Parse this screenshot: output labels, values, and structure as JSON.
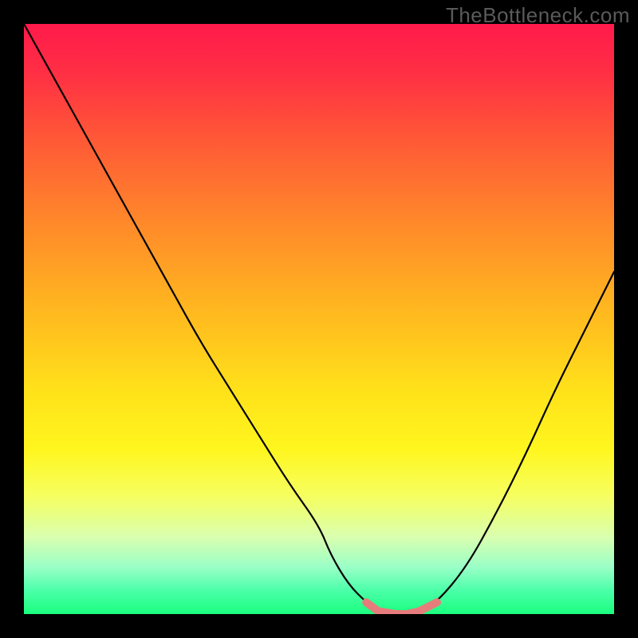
{
  "watermark": "TheBottleneck.com",
  "chart_data": {
    "type": "line",
    "title": "",
    "xlabel": "",
    "ylabel": "",
    "xlim": [
      0,
      100
    ],
    "ylim": [
      0,
      100
    ],
    "x": [
      0,
      5,
      10,
      15,
      20,
      25,
      30,
      35,
      40,
      45,
      50,
      52,
      55,
      58,
      60,
      63,
      65,
      67,
      70,
      75,
      80,
      85,
      90,
      95,
      100
    ],
    "values": [
      100,
      91,
      82,
      73,
      64,
      55,
      46,
      38,
      30,
      22,
      15,
      10,
      5,
      2,
      0.5,
      0,
      0,
      0.5,
      2,
      8,
      17,
      27,
      38,
      48,
      58
    ],
    "highlight": {
      "x_range": [
        58,
        70
      ],
      "color": "#e77c7c",
      "note": "flat valley segment"
    },
    "background": "vertical heat gradient red→yellow→green",
    "series_color": "#000000"
  }
}
